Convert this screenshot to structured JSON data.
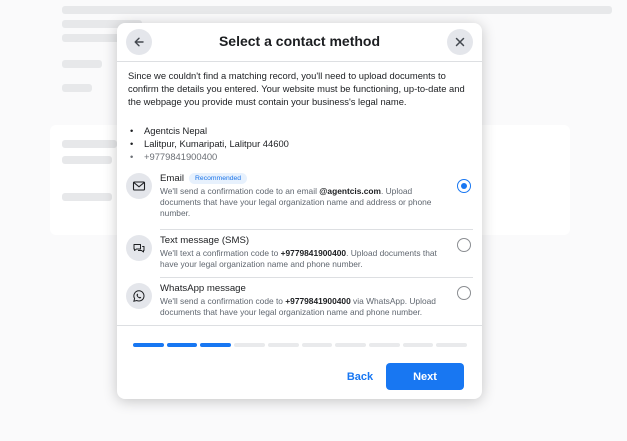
{
  "dialog": {
    "title": "Select a contact method",
    "intro": "Since we couldn't find a matching record, you'll need to upload documents to confirm the details you entered. Your website must be functioning, up-to-date and the webpage you provide must contain your business's legal name.",
    "details": [
      "Agentcis Nepal",
      "Lalitpur, Kumaripati, Lalitpur 44600",
      "+9779841900400"
    ],
    "options": [
      {
        "id": "email",
        "icon": "envelope-icon",
        "title": "Email",
        "badge": "Recommended",
        "desc_before": "We'll send a confirmation code to an email ",
        "desc_bold": "@agentcis.com",
        "desc_after": ". Upload documents that have your legal organization name and address or phone number.",
        "selected": true
      },
      {
        "id": "sms",
        "icon": "chat-bubbles-icon",
        "title": "Text message (SMS)",
        "badge": "",
        "desc_before": "We'll text a confirmation code to ",
        "desc_bold": "+9779841900400",
        "desc_after": ". Upload documents that have your legal organization name and phone number.",
        "selected": false
      },
      {
        "id": "whatsapp",
        "icon": "whatsapp-icon",
        "title": "WhatsApp message",
        "badge": "",
        "desc_before": "We'll send a confirmation code to ",
        "desc_bold": "+9779841900400",
        "desc_after": " via WhatsApp. Upload documents that have your legal organization name and phone number.",
        "selected": false
      }
    ],
    "progress": {
      "current_step": 3,
      "total_steps": 10
    },
    "back_label": "Back",
    "next_label": "Next"
  },
  "colors": {
    "accent": "#1877f2",
    "badge_bg": "#e7f1fd",
    "divider": "#dddfe2"
  }
}
